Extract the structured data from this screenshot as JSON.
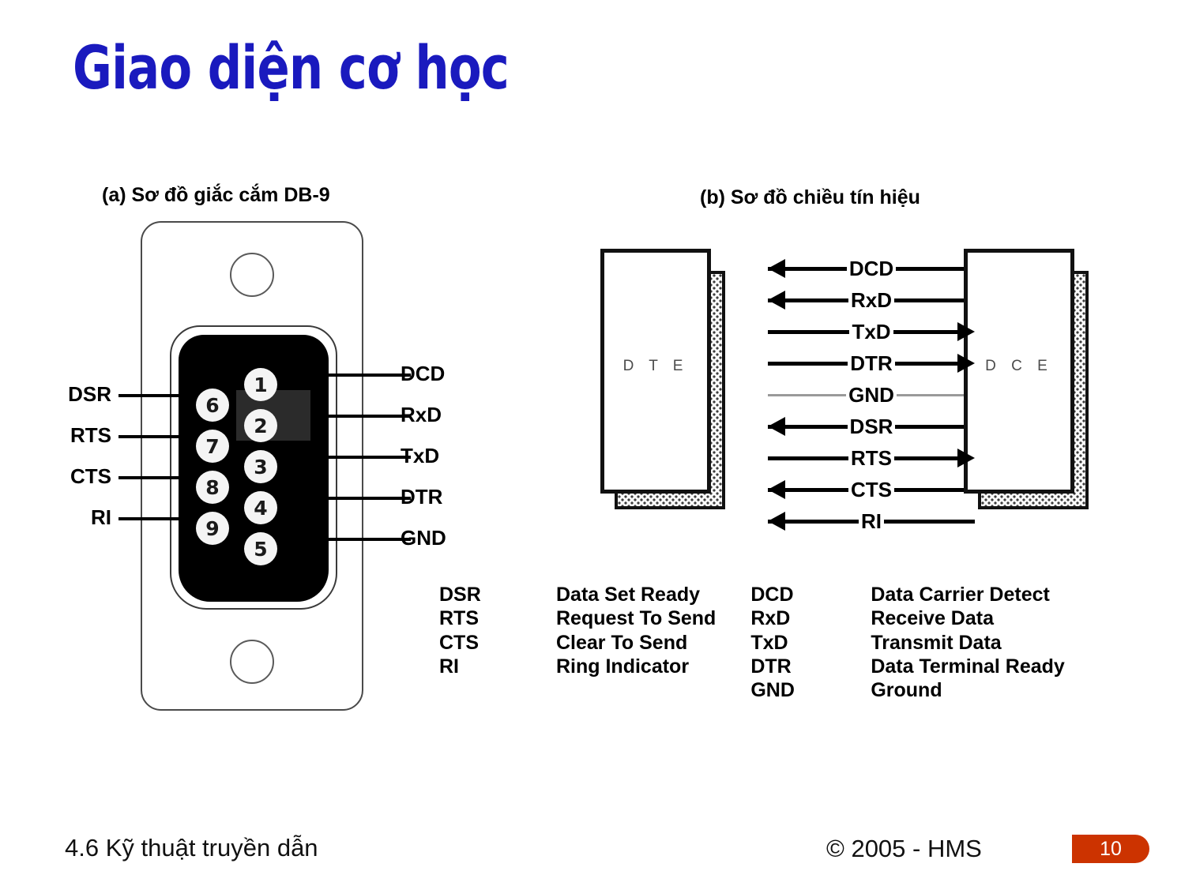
{
  "slide": {
    "title": "Giao diện cơ học",
    "title_color": "#1a1aBE"
  },
  "panel_a": {
    "heading": "(a) Sơ đồ giắc cắm DB-9",
    "connector_type": "DB-9 male",
    "pins_right_column": [
      {
        "number": "1",
        "label": "DCD"
      },
      {
        "number": "2",
        "label": "RxD"
      },
      {
        "number": "3",
        "label": "TxD"
      },
      {
        "number": "4",
        "label": "DTR"
      },
      {
        "number": "5",
        "label": "GND"
      }
    ],
    "pins_left_column": [
      {
        "number": "6",
        "label": "DSR"
      },
      {
        "number": "7",
        "label": "RTS"
      },
      {
        "number": "8",
        "label": "CTS"
      },
      {
        "number": "9",
        "label": "RI"
      }
    ]
  },
  "panel_b": {
    "heading": "(b) Sơ đồ chiều tín hiệu",
    "left_endpoint": "D T E",
    "right_endpoint": "D C E",
    "signals": [
      {
        "name": "DCD",
        "direction": "left",
        "style": "black"
      },
      {
        "name": "RxD",
        "direction": "left",
        "style": "black"
      },
      {
        "name": "TxD",
        "direction": "right",
        "style": "black"
      },
      {
        "name": "DTR",
        "direction": "right",
        "style": "black"
      },
      {
        "name": "GND",
        "direction": "none",
        "style": "gray"
      },
      {
        "name": "DSR",
        "direction": "left",
        "style": "black"
      },
      {
        "name": "RTS",
        "direction": "right",
        "style": "black"
      },
      {
        "name": "CTS",
        "direction": "left",
        "style": "black"
      },
      {
        "name": "RI",
        "direction": "left",
        "style": "black"
      }
    ]
  },
  "legend": {
    "left_column": [
      {
        "abbr": "DSR",
        "desc": "Data Set Ready"
      },
      {
        "abbr": "RTS",
        "desc": "Request To Send"
      },
      {
        "abbr": "CTS",
        "desc": "Clear To Send"
      },
      {
        "abbr": "RI",
        "desc": "Ring Indicator"
      }
    ],
    "right_column": [
      {
        "abbr": "DCD",
        "desc": "Data Carrier Detect"
      },
      {
        "abbr": "RxD",
        "desc": "Receive Data"
      },
      {
        "abbr": "TxD",
        "desc": "Transmit Data"
      },
      {
        "abbr": "DTR",
        "desc": "Data Terminal Ready"
      },
      {
        "abbr": "GND",
        "desc": "Ground"
      }
    ]
  },
  "footer": {
    "section": "4.6  Kỹ thuật truyền dẫn",
    "copyright": "© 2005 - HMS",
    "page_number": "10",
    "badge_color": "#cc3300"
  }
}
